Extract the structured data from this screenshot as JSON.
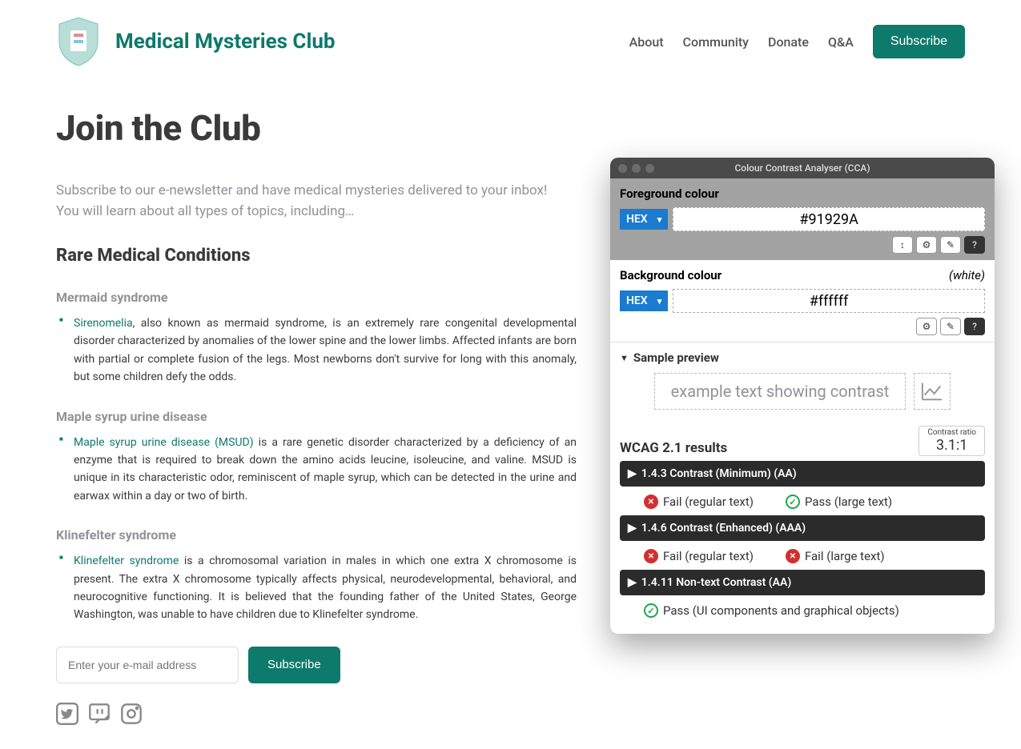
{
  "site": {
    "title": "Medical Mysteries Club"
  },
  "nav": {
    "about": "About",
    "community": "Community",
    "donate": "Donate",
    "qa": "Q&A",
    "subscribe": "Subscribe"
  },
  "page": {
    "title": "Join the Club",
    "intro": "Subscribe to our e-newsletter and have medical mysteries delivered to your inbox! You will learn about all types of topics, including…",
    "section_heading": "Rare Medical Conditions"
  },
  "conditions": {
    "mermaid": {
      "name": "Mermaid syndrome",
      "link": "Sirenomelia",
      "text": ", also known as mermaid syndrome, is an extremely rare congenital developmental disorder characterized by anomalies of the lower spine and the lower limbs. Affected infants are born with partial or complete fusion of the legs. Most newborns don't survive for long with this anomaly, but some children defy the odds."
    },
    "maple": {
      "name": "Maple syrup urine disease",
      "link": "Maple syrup urine disease (MSUD)",
      "text": " is a rare genetic disorder characterized by a deficiency of an enzyme that is required to break down the amino acids leucine, isoleucine, and valine. MSUD is unique in its characteristic odor, reminiscent of maple syrup, which can be detected in the urine and earwax within a day or two of birth."
    },
    "klinefelter": {
      "name": "Klinefelter syndrome",
      "link": "Klinefelter syndrome",
      "text": " is a chromosomal variation in males in which one extra X chromosome is present. The extra X chromosome typically affects physical, neurodevelopmental, behavioral, and neurocognitive functioning. It is believed that the founding father of the United States, George Washington, was unable to have children due to Klinefelter syndrome."
    }
  },
  "form": {
    "placeholder": "Enter your e-mail address",
    "button": "Subscribe"
  },
  "cca": {
    "title": "Colour Contrast Analyser (CCA)",
    "fg_label": "Foreground colour",
    "bg_label": "Background colour",
    "white_note": "(white)",
    "hex_label": "HEX",
    "fg_value": "#91929A",
    "bg_value": "#ffffff",
    "sample_header": "Sample preview",
    "sample_text": "example text showing contrast",
    "results_title": "WCAG 2.1 results",
    "ratio_label": "Contrast ratio",
    "ratio_value": "3.1:1",
    "sections": {
      "aa_min": "1.4.3 Contrast (Minimum) (AA)",
      "aaa": "1.4.6 Contrast (Enhanced) (AAA)",
      "nontext": "1.4.11 Non-text Contrast (AA)"
    },
    "fail_regular": "Fail (regular text)",
    "pass_large": "Pass (large text)",
    "fail_large": "Fail (large text)",
    "pass_ui": "Pass (UI components and graphical objects)"
  }
}
